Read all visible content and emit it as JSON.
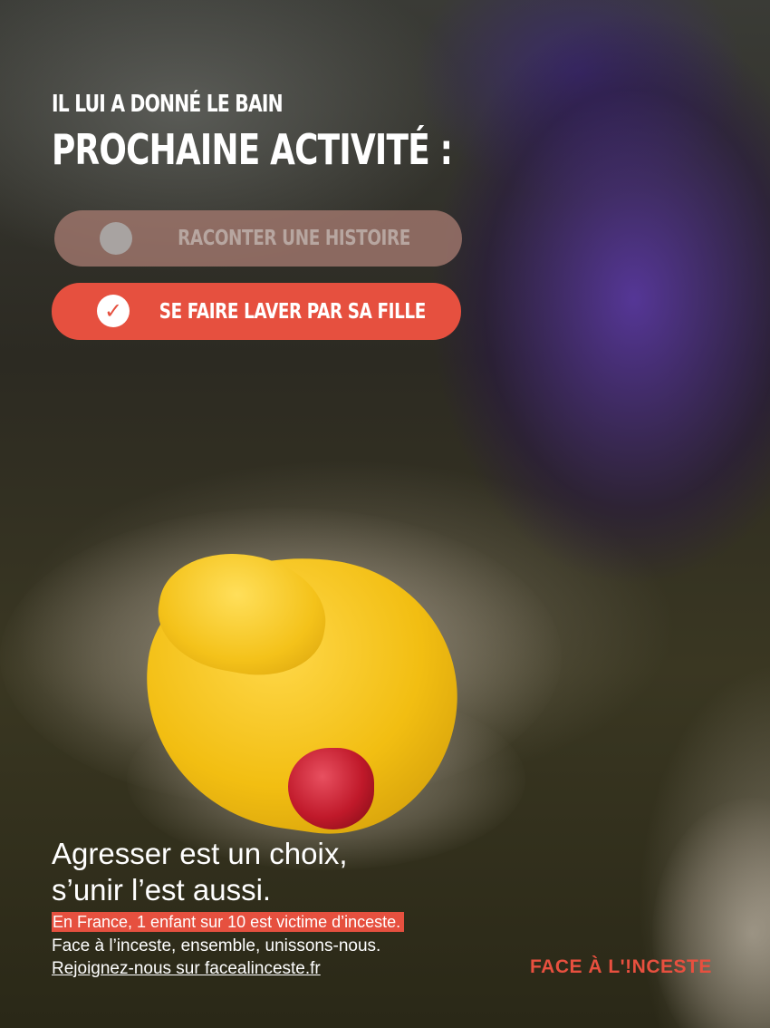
{
  "headline": {
    "line1": "IL LUI A DONNÉ LE BAIN",
    "line2": "PROCHAINE ACTIVITÉ :"
  },
  "choices": [
    {
      "label": "RACONTER UNE HISTOIRE",
      "selected": false
    },
    {
      "label": "SE FAIRE LAVER PAR SA FILLE",
      "selected": true,
      "check_icon": "✓"
    }
  ],
  "slogan": {
    "line1": "Agresser est un choix,",
    "line2": "s’unir l’est aussi."
  },
  "stat": "En France, 1 enfant sur 10 est victime d’inceste.",
  "body_line": "Face à l’inceste, ensemble, unissons-nous.",
  "cta": "Rejoignez-nous sur facealinceste.fr",
  "logo": "FACE À L'!NCESTE",
  "colors": {
    "accent": "#e6503f",
    "choice_inactive": "#a0766c",
    "text": "#ffffff"
  }
}
